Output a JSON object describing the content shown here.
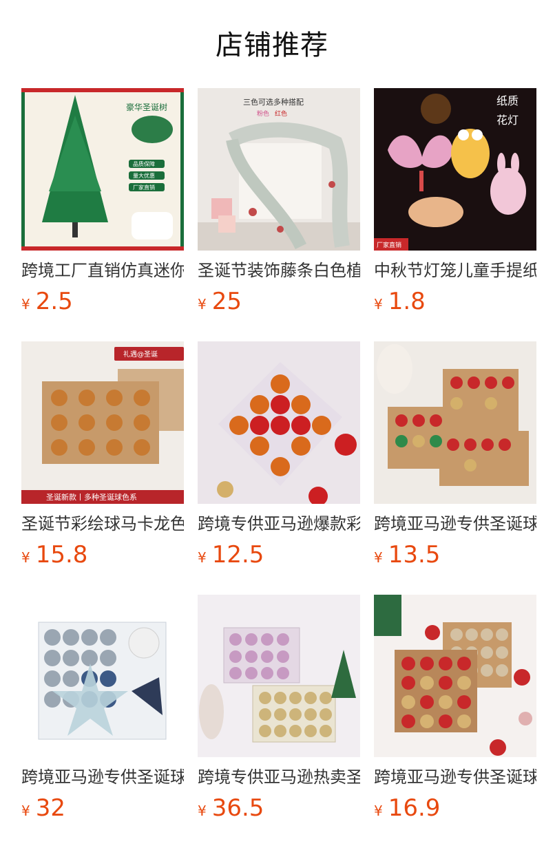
{
  "header": {
    "title": "店铺推荐"
  },
  "colors": {
    "price": "#e8490f",
    "title": "#111111"
  },
  "products": [
    {
      "name": "跨境工厂直销仿真迷你圣诞树",
      "currency": "¥",
      "price": "2.5",
      "image_icon": "christmas-tree-image",
      "image_texts": [
        "豪华圣诞树",
        "品质保障",
        "量大优惠",
        "厂家直销"
      ]
    },
    {
      "name": "圣诞节装饰藤条白色植绒",
      "currency": "¥",
      "price": "25",
      "image_icon": "garland-image",
      "image_texts": [
        "三色可选多种搭配",
        "粉色",
        "红色"
      ]
    },
    {
      "name": "中秋节灯笼儿童手提纸质",
      "currency": "¥",
      "price": "1.8",
      "image_icon": "lantern-image",
      "image_texts": [
        "纸质",
        "花灯",
        "厂家直销"
      ]
    },
    {
      "name": "圣诞节彩绘球马卡龙色系",
      "currency": "¥",
      "price": "15.8",
      "image_icon": "ornament-box-image",
      "image_texts": [
        "礼遇@圣诞",
        "圣诞新款丨多种圣诞球色系"
      ]
    },
    {
      "name": "跨境专供亚马逊爆款彩绘球",
      "currency": "¥",
      "price": "12.5",
      "image_icon": "ornament-box-image",
      "image_texts": []
    },
    {
      "name": "跨境亚马逊专供圣诞球套装",
      "currency": "¥",
      "price": "13.5",
      "image_icon": "ornament-box-image",
      "image_texts": []
    },
    {
      "name": "跨境亚马逊专供圣诞球套装",
      "currency": "¥",
      "price": "32",
      "image_icon": "ornament-box-image",
      "image_texts": []
    },
    {
      "name": "跨境专供亚马逊热卖圣诞球",
      "currency": "¥",
      "price": "36.5",
      "image_icon": "ornament-box-image",
      "image_texts": []
    },
    {
      "name": "跨境亚马逊专供圣诞球套装",
      "currency": "¥",
      "price": "16.9",
      "image_icon": "ornament-box-image",
      "image_texts": []
    }
  ]
}
